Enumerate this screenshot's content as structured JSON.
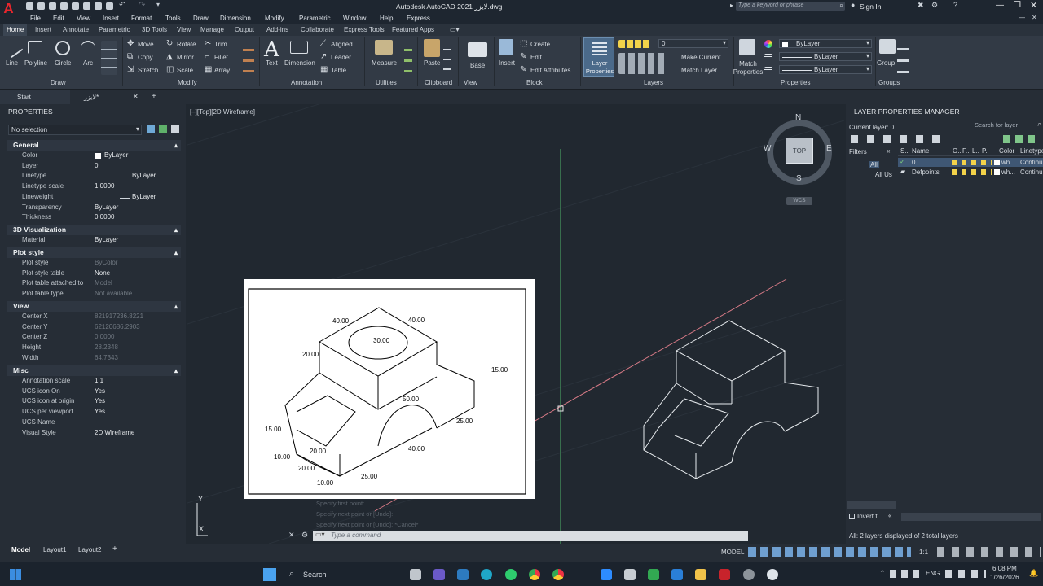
{
  "titlebar": {
    "title": "Autodesk AutoCAD 2021  لايزر.dwg",
    "search_placeholder": "Type a keyword or phrase",
    "sign_in": "Sign In"
  },
  "menu": [
    "File",
    "Edit",
    "View",
    "Insert",
    "Format",
    "Tools",
    "Draw",
    "Dimension",
    "Modify",
    "Parametric",
    "Window",
    "Help",
    "Express"
  ],
  "ribbon_tabs": [
    "Home",
    "Insert",
    "Annotate",
    "Parametric",
    "3D Tools",
    "View",
    "Manage",
    "Output",
    "Add-ins",
    "Collaborate",
    "Express Tools",
    "Featured Apps"
  ],
  "ribbon": {
    "draw": {
      "line": "Line",
      "polyline": "Polyline",
      "circle": "Circle",
      "arc": "Arc",
      "title": "Draw"
    },
    "modify": {
      "move": "Move",
      "rotate": "Rotate",
      "trim": "Trim",
      "copy": "Copy",
      "mirror": "Mirror",
      "fillet": "Fillet",
      "stretch": "Stretch",
      "scale": "Scale",
      "array": "Array",
      "title": "Modify"
    },
    "annotation": {
      "text": "Text",
      "dimension": "Dimension",
      "aligned": "Aligned",
      "leader": "Leader",
      "table": "Table",
      "title": "Annotation"
    },
    "utilities": {
      "measure": "Measure",
      "title": "Utilities"
    },
    "clipboard": {
      "paste": "Paste",
      "title": "Clipboard"
    },
    "view": {
      "base": "Base",
      "title": "View"
    },
    "block": {
      "insert": "Insert",
      "create": "Create",
      "edit": "Edit",
      "edit_attributes": "Edit Attributes",
      "title": "Block"
    },
    "layers": {
      "layer_properties": "Layer Properties",
      "current_layer": "0",
      "make_current": "Make Current",
      "match_layer": "Match Layer",
      "title": "Layers"
    },
    "properties": {
      "match": "Match Properties",
      "bylayer1": "ByLayer",
      "bylayer2": "ByLayer",
      "bylayer3": "ByLayer",
      "title": "Properties"
    },
    "groups": {
      "group": "Group",
      "title": "Groups"
    }
  },
  "doc_tabs": {
    "start": "Start",
    "drawing": "لايزر*"
  },
  "properties_panel": {
    "title": "PROPERTIES",
    "selection": "No selection",
    "general": {
      "title": "General",
      "rows": [
        {
          "k": "Color",
          "v": "ByLayer"
        },
        {
          "k": "Layer",
          "v": "0"
        },
        {
          "k": "Linetype",
          "v": "ByLayer"
        },
        {
          "k": "Linetype scale",
          "v": "1.0000"
        },
        {
          "k": "Lineweight",
          "v": "ByLayer"
        },
        {
          "k": "Transparency",
          "v": "ByLayer"
        },
        {
          "k": "Thickness",
          "v": "0.0000"
        }
      ]
    },
    "viz": {
      "title": "3D Visualization",
      "rows": [
        {
          "k": "Material",
          "v": "ByLayer"
        }
      ]
    },
    "plot": {
      "title": "Plot style",
      "rows": [
        {
          "k": "Plot style",
          "v": "ByColor"
        },
        {
          "k": "Plot style table",
          "v": "None"
        },
        {
          "k": "Plot table attached to",
          "v": "Model"
        },
        {
          "k": "Plot table type",
          "v": "Not available"
        }
      ]
    },
    "view": {
      "title": "View",
      "rows": [
        {
          "k": "Center X",
          "v": "821917236.8221"
        },
        {
          "k": "Center Y",
          "v": "62120686.2903"
        },
        {
          "k": "Center Z",
          "v": "0.0000"
        },
        {
          "k": "Height",
          "v": "28.2348"
        },
        {
          "k": "Width",
          "v": "64.7343"
        }
      ]
    },
    "misc": {
      "title": "Misc",
      "rows": [
        {
          "k": "Annotation scale",
          "v": "1:1"
        },
        {
          "k": "UCS icon On",
          "v": "Yes"
        },
        {
          "k": "UCS icon at origin",
          "v": "Yes"
        },
        {
          "k": "UCS per viewport",
          "v": "Yes"
        },
        {
          "k": "UCS Name",
          "v": ""
        },
        {
          "k": "Visual Style",
          "v": "2D Wireframe"
        }
      ]
    }
  },
  "viewport": {
    "label": "[–][Top][2D Wireframe]",
    "viewcube": {
      "n": "N",
      "s": "S",
      "e": "E",
      "w": "W",
      "top": "TOP",
      "ucs": "WCS"
    },
    "dims": {
      "d1": "40.00",
      "d2": "40.00",
      "d3": "30.00",
      "d4": "20.00",
      "d5": "15.00",
      "d6": "50.00",
      "d7": "25.00",
      "d8": "15.00",
      "d9": "40.00",
      "d10": "20.00",
      "d11": "10.00",
      "d12": "20.00",
      "d13": "25.00",
      "d14": "10.00"
    },
    "cmd_history": [
      "Specify first point:",
      "Specify next point or [Undo]:",
      "Specify next point or [Undo]: *Cancel*"
    ],
    "cmd_placeholder": "Type a command"
  },
  "layer_manager": {
    "title": "LAYER PROPERTIES MANAGER",
    "current": "Current layer: 0",
    "search_placeholder": "Search for layer",
    "filters": "Filters",
    "tree_all": "All",
    "tree_used": "All Us",
    "cols": {
      "s": "S..",
      "name": "Name",
      "o": "O..",
      "f": "F..",
      "l": "L..",
      "p": "P..",
      "color": "Color",
      "linetype": "Linetype"
    },
    "rows": [
      {
        "name": "0",
        "color": "wh...",
        "linetype": "Continu"
      },
      {
        "name": "Defpoints",
        "color": "wh...",
        "linetype": "Continu"
      }
    ],
    "invert": "Invert fi",
    "status": "All: 2 layers displayed of 2 total layers"
  },
  "statusbar": {
    "tabs": [
      "Model",
      "Layout1",
      "Layout2"
    ],
    "model": "MODEL",
    "scale": "1:1"
  },
  "taskbar": {
    "search": "Search",
    "lang": "ENG",
    "time": "6:08 PM",
    "date": "1/26/2026"
  }
}
